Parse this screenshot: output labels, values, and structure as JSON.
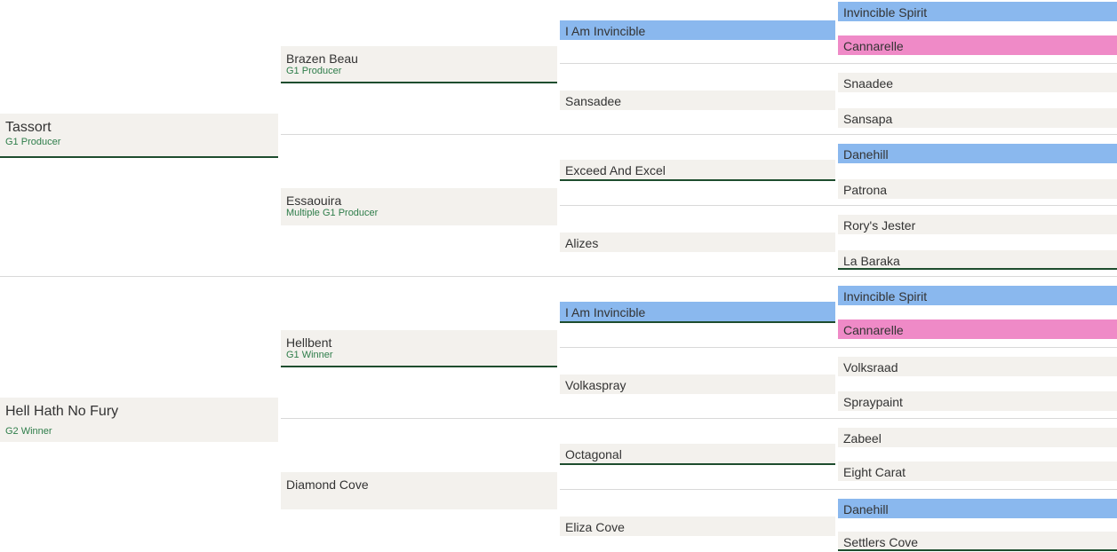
{
  "pedigree": {
    "gen1": [
      {
        "name": "Tassort",
        "note": "G1 Producer"
      },
      {
        "name": "Hell Hath No Fury",
        "note": "G2 Winner"
      }
    ],
    "gen2": [
      {
        "name": "Brazen Beau",
        "note": "G1 Producer"
      },
      {
        "name": "Essaouira",
        "note": "Multiple G1 Producer"
      },
      {
        "name": "Hellbent",
        "note": "G1 Winner"
      },
      {
        "name": "Diamond Cove",
        "note": ""
      }
    ],
    "gen3": [
      {
        "name": "I Am Invincible"
      },
      {
        "name": "Sansadee"
      },
      {
        "name": "Exceed And Excel"
      },
      {
        "name": "Alizes"
      },
      {
        "name": "I Am Invincible"
      },
      {
        "name": "Volkaspray"
      },
      {
        "name": "Octagonal"
      },
      {
        "name": "Eliza Cove"
      }
    ],
    "gen4": [
      {
        "name": "Invincible Spirit"
      },
      {
        "name": "Cannarelle"
      },
      {
        "name": "Snaadee"
      },
      {
        "name": "Sansapa"
      },
      {
        "name": "Danehill"
      },
      {
        "name": "Patrona"
      },
      {
        "name": "Rory's Jester"
      },
      {
        "name": "La Baraka"
      },
      {
        "name": "Invincible Spirit"
      },
      {
        "name": "Cannarelle"
      },
      {
        "name": "Volksraad"
      },
      {
        "name": "Spraypaint"
      },
      {
        "name": "Zabeel"
      },
      {
        "name": "Eight Carat"
      },
      {
        "name": "Danehill"
      },
      {
        "name": "Settlers Cove"
      }
    ]
  },
  "colors": {
    "highlight_blue": "#8ab8ee",
    "highlight_pink": "#ef8ac7",
    "cell_bg": "#f3f1ed",
    "underline": "#1e4d2e",
    "note_text": "#2e7d4a"
  }
}
